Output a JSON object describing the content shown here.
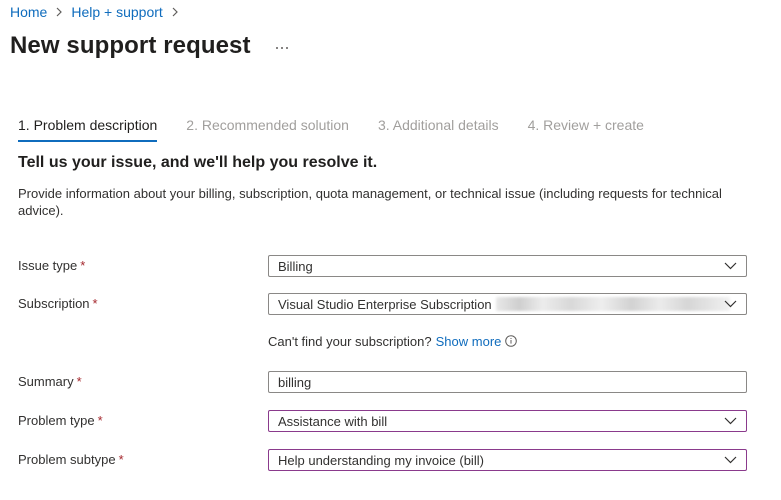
{
  "breadcrumb": {
    "home": "Home",
    "help_support": "Help + support"
  },
  "page": {
    "title": "New support request",
    "more_label": "⋯"
  },
  "tabs": [
    {
      "label": "1. Problem description",
      "active": true
    },
    {
      "label": "2. Recommended solution",
      "active": false
    },
    {
      "label": "3. Additional details",
      "active": false
    },
    {
      "label": "4. Review + create",
      "active": false
    }
  ],
  "section": {
    "heading": "Tell us your issue, and we'll help you resolve it.",
    "description": "Provide information about your billing, subscription, quota management, or technical issue (including requests for technical advice)."
  },
  "form": {
    "required_marker": "*",
    "issue_type": {
      "label": "Issue type",
      "value": "Billing"
    },
    "subscription": {
      "label": "Subscription",
      "value": "Visual Studio Enterprise Subscription"
    },
    "subscription_helper": {
      "text": "Can't find your subscription?",
      "link": "Show more"
    },
    "summary": {
      "label": "Summary",
      "value": "billing"
    },
    "problem_type": {
      "label": "Problem type",
      "value": "Assistance with bill"
    },
    "problem_subtype": {
      "label": "Problem subtype",
      "value": "Help understanding my invoice (bill)"
    }
  },
  "colors": {
    "accent": "#0f6cbd",
    "required": "#a4262c",
    "focused_border": "#8a3a8c"
  }
}
